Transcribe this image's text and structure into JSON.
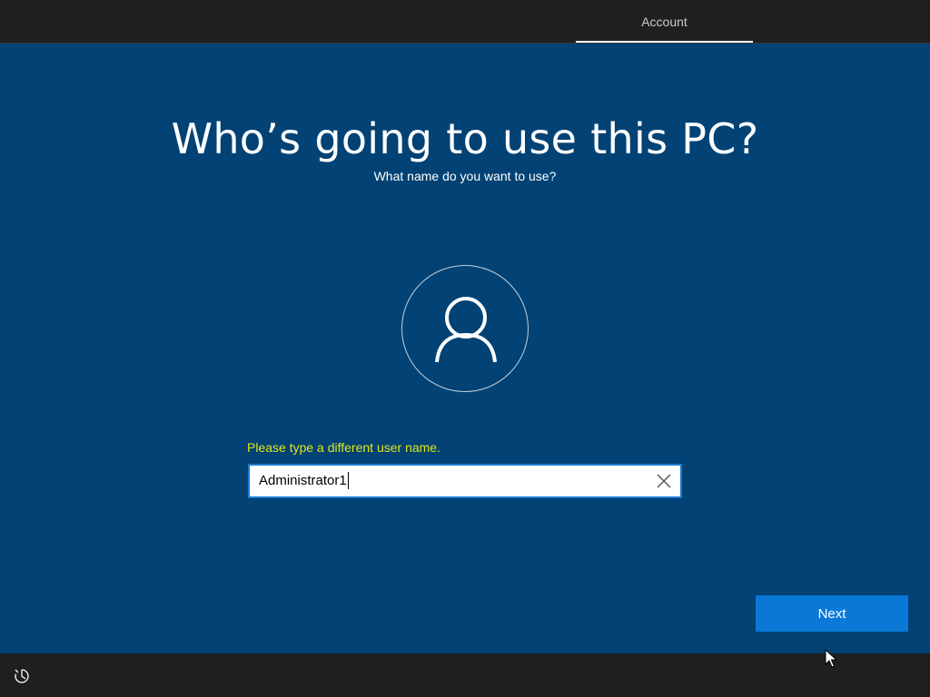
{
  "header": {
    "tabs": [
      {
        "label": "Account",
        "active": true
      }
    ]
  },
  "main": {
    "title": "Who’s going to use this PC?",
    "subtitle": "What name do you want to use?",
    "avatar_icon": "user-icon",
    "error_message": "Please type a different user name.",
    "username_field": {
      "value": "Administrator1",
      "clear_icon": "close-icon"
    },
    "next_label": "Next"
  },
  "footer": {
    "ease_of_access_icon": "ease-of-access-icon"
  },
  "colors": {
    "background": "#024274",
    "bar": "#1f1f1f",
    "accent": "#0a78d7",
    "error": "#e2e51a"
  }
}
